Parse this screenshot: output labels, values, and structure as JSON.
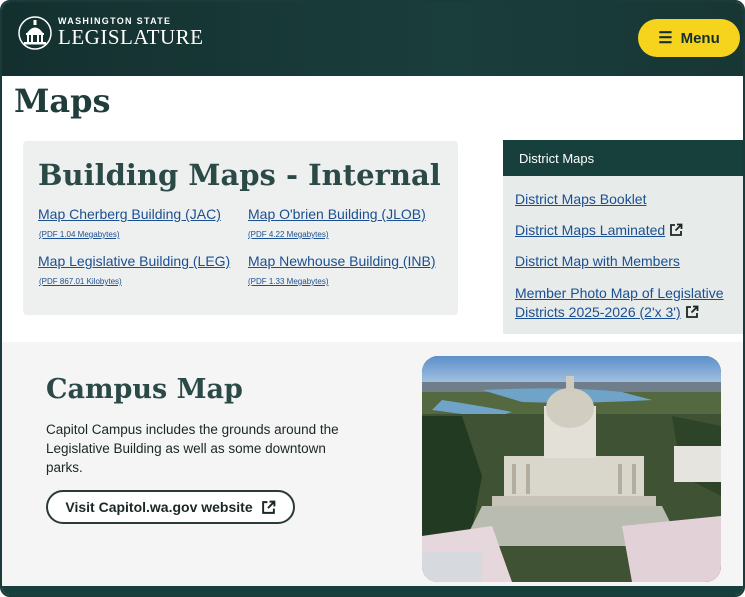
{
  "header": {
    "logo_small": "WASHINGTON STATE",
    "logo_big": "LEGISLATURE",
    "menu_label": "Menu"
  },
  "page": {
    "title": "Maps"
  },
  "building_maps": {
    "title": "Building Maps - Internal",
    "links": [
      {
        "label": "Map Cherberg Building (JAC)",
        "size": "(PDF 1.04 Megabytes)"
      },
      {
        "label": "Map O'brien Building (JLOB)",
        "size": "(PDF 4.22 Megabytes)"
      },
      {
        "label": "Map Legislative Building (LEG)",
        "size": "(PDF 867.01 Kilobytes)"
      },
      {
        "label": "Map Newhouse Building (INB)",
        "size": "(PDF 1.33 Megabytes)"
      }
    ]
  },
  "district_maps": {
    "heading": "District Maps",
    "links": [
      {
        "label": "District Maps Booklet",
        "external": false
      },
      {
        "label": "District Maps Laminated",
        "external": true
      },
      {
        "label": "District Map with Members",
        "external": false
      },
      {
        "label": "Member Photo Map of Legislative Districts 2025-2026 (2'x 3')",
        "external": true
      }
    ]
  },
  "campus": {
    "title": "Campus Map",
    "description": "Capitol Campus includes the grounds around the Legislative Building as well as some downtown parks.",
    "button_label": "Visit Capitol.wa.gov website"
  },
  "colors": {
    "header_bg": "#17403d",
    "menu_button": "#f6d31c",
    "link": "#1c4f91"
  }
}
